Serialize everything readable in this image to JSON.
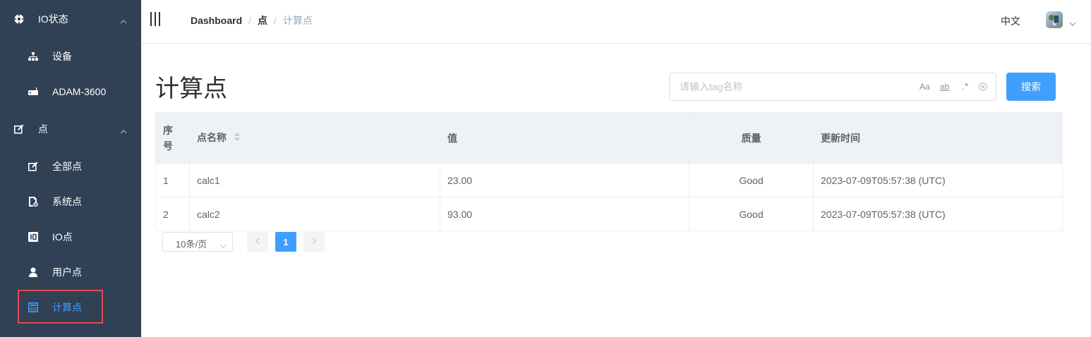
{
  "sidebar": {
    "groups": [
      {
        "label": "IO状态",
        "icon": "io-status-icon"
      },
      {
        "label": "点",
        "icon": "point-edit-icon"
      }
    ],
    "items": [
      {
        "label": "设备",
        "icon": "sitemap-icon"
      },
      {
        "label": "ADAM-3600",
        "icon": "router-icon"
      },
      {
        "label": "全部点",
        "icon": "edit-icon"
      },
      {
        "label": "系统点",
        "icon": "system-doc-icon"
      },
      {
        "label": "IO点",
        "icon": "io-badge-icon"
      },
      {
        "label": "用户点",
        "icon": "user-icon"
      },
      {
        "label": "计算点",
        "icon": "calculator-icon"
      }
    ],
    "active_item": "计算点",
    "active_color": "#409EFF"
  },
  "navbar": {
    "breadcrumb": [
      "Dashboard",
      "点",
      "计算点"
    ],
    "language": "中文"
  },
  "page": {
    "title": "计算点"
  },
  "search": {
    "placeholder": "请输入tag名称",
    "value": "",
    "options": {
      "match_case": "Aa",
      "whole_word": "ab",
      "regex": ".*"
    },
    "button_label": "搜索"
  },
  "table": {
    "columns": [
      "序号",
      "点名称",
      "值",
      "质量",
      "更新时间"
    ],
    "rows": [
      [
        "1",
        "calc1",
        "23.00",
        "Good",
        "2023-07-09T05:57:38 (UTC)"
      ],
      [
        "2",
        "calc2",
        "93.00",
        "Good",
        "2023-07-09T05:57:38 (UTC)"
      ]
    ]
  },
  "pagination": {
    "page_size_label": "10条/页",
    "current_page": "1"
  },
  "colors": {
    "sidebar_bg": "#304156",
    "primary": "#409EFF",
    "highlight_border": "#e5484d"
  }
}
